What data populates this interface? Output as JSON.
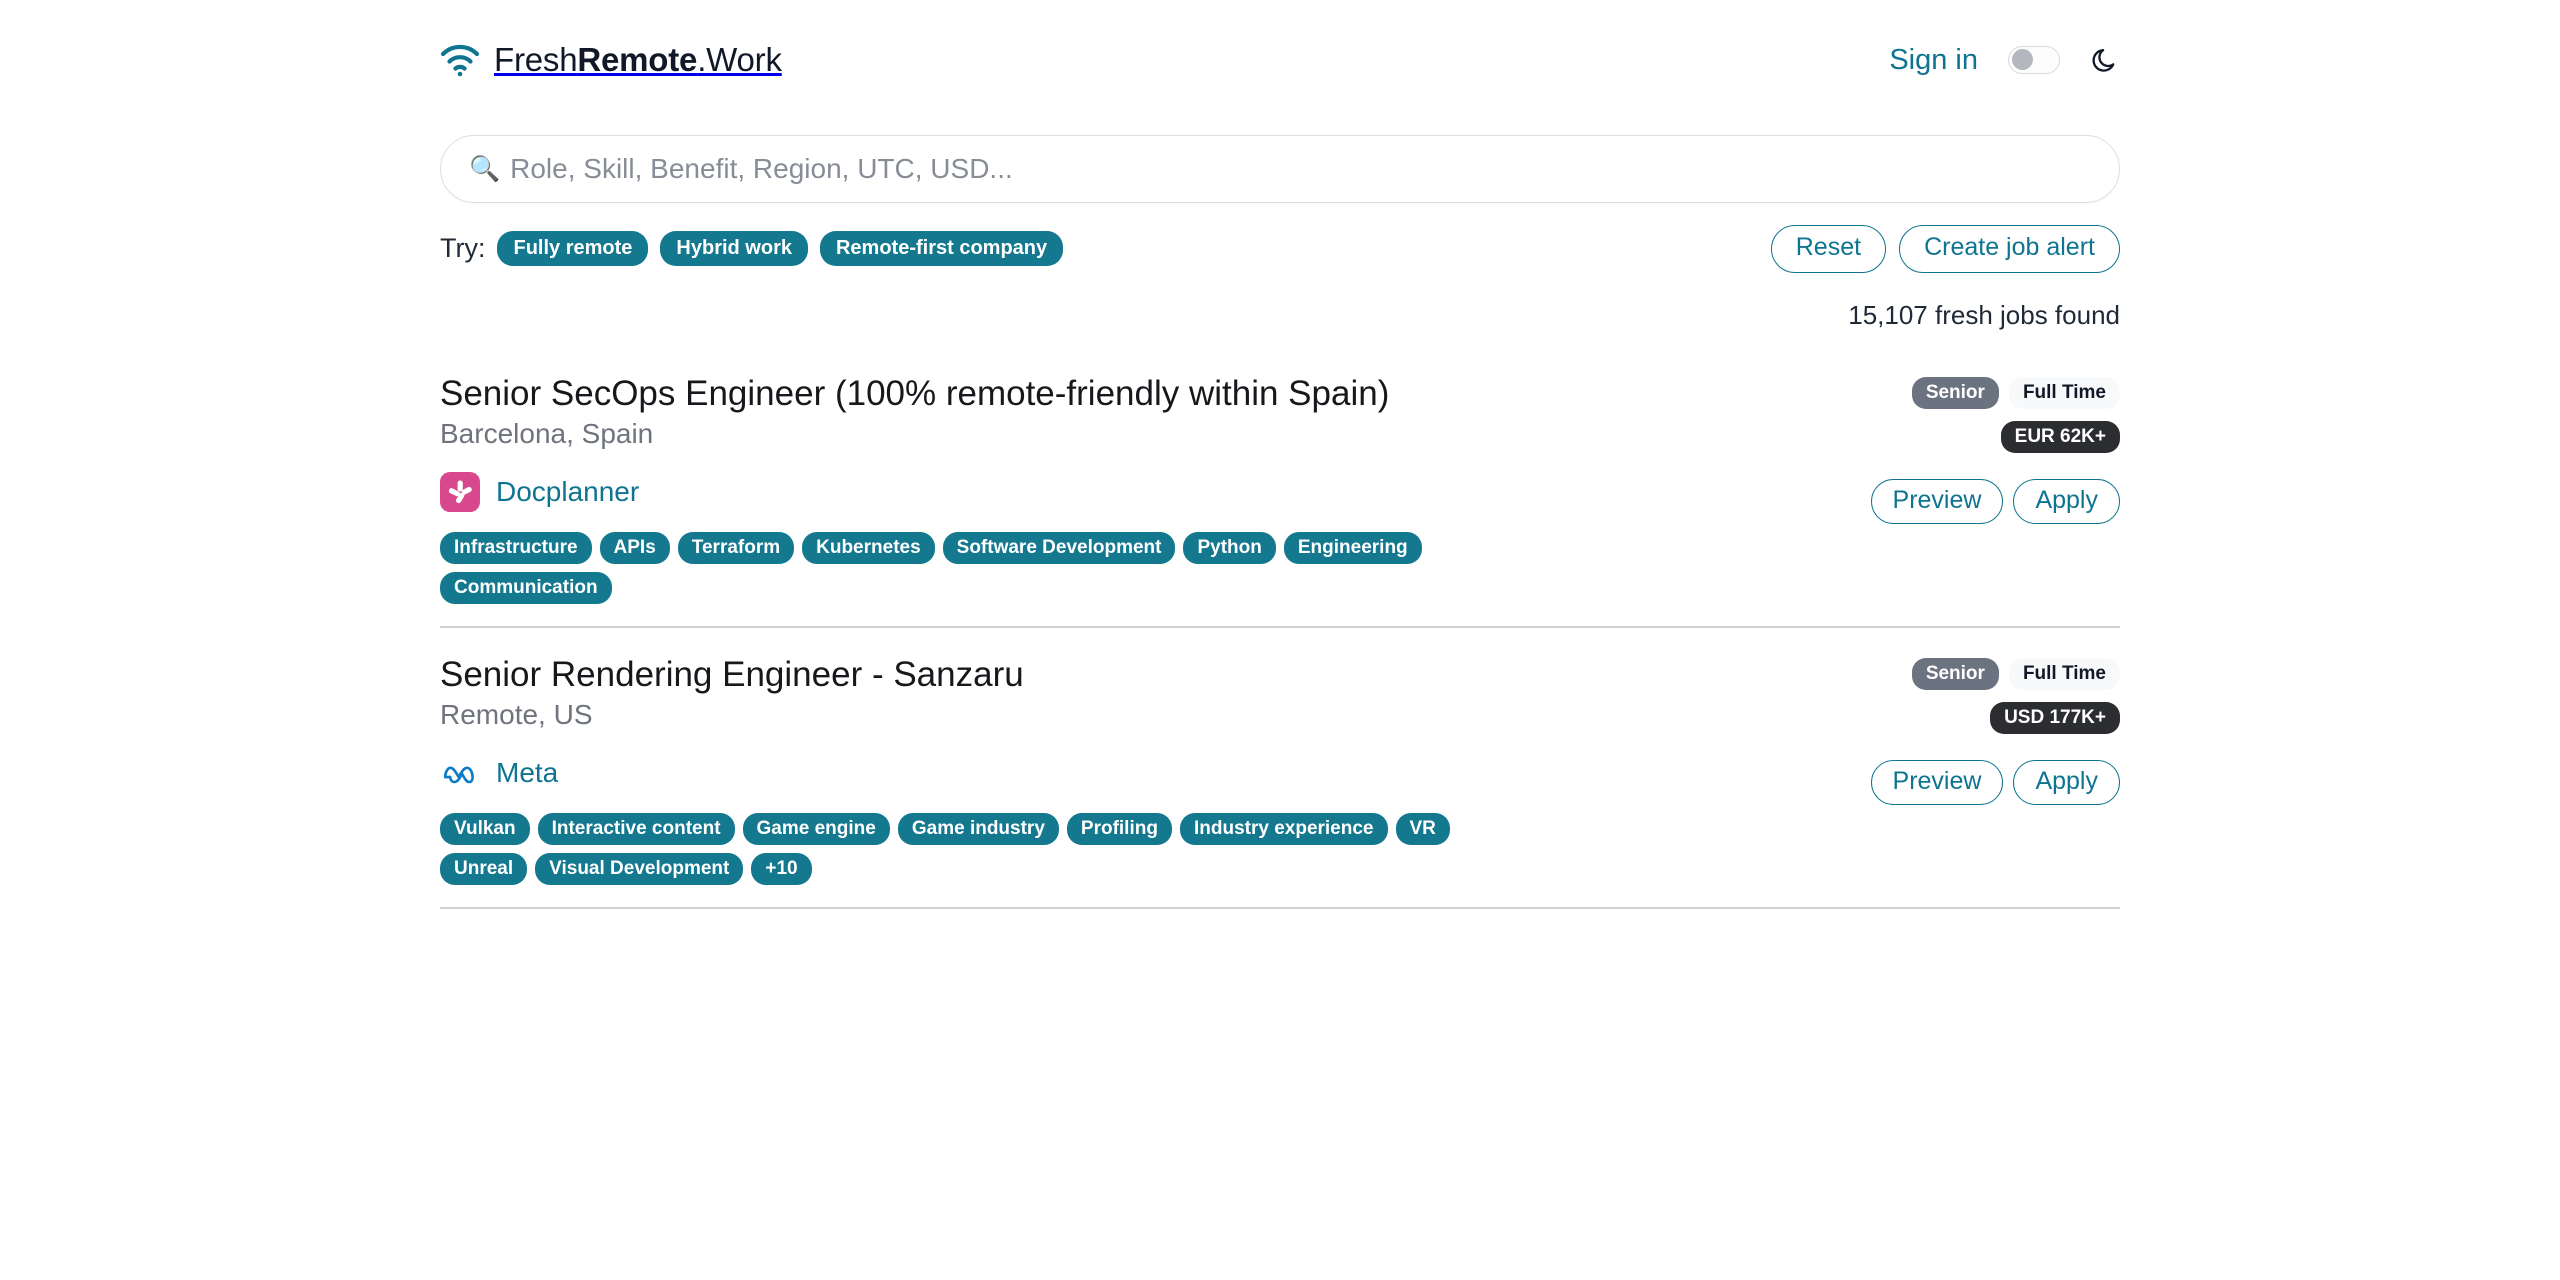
{
  "header": {
    "logo_icon": "wifi-icon",
    "brand_prefix": "Fresh",
    "brand_bold": "Remote",
    "brand_suffix": ".Work",
    "signin_label": "Sign in",
    "theme_toggle_state": "off",
    "dark_mode_icon": "moon-icon"
  },
  "search": {
    "icon": "search-icon",
    "value": "",
    "placeholder": "Role, Skill, Benefit, Region, UTC, USD..."
  },
  "suggestions": {
    "label": "Try:",
    "chips": [
      "Fully remote",
      "Hybrid work",
      "Remote-first company"
    ]
  },
  "actions": {
    "reset_label": "Reset",
    "create_alert_label": "Create job alert"
  },
  "results": {
    "count_text": "15,107 fresh jobs found"
  },
  "colors": {
    "accent_teal": "#0e7490",
    "chip_teal": "#14788f",
    "badge_gray": "#6b7280",
    "badge_dark": "#2b2d31",
    "docplanner_pink": "#d8488c",
    "meta_blue": "#0b7cc7",
    "muted_text": "#6f747c"
  },
  "jobs": [
    {
      "title": "Senior SecOps Engineer (100% remote-friendly within Spain)",
      "location": "Barcelona, Spain",
      "company": "Docplanner",
      "company_logo": "docplanner-logo-icon",
      "seniority": "Senior",
      "employment_type": "Full Time",
      "salary": "EUR 62K+",
      "preview_label": "Preview",
      "apply_label": "Apply",
      "tags": [
        "Infrastructure",
        "APIs",
        "Terraform",
        "Kubernetes",
        "Software Development",
        "Python",
        "Engineering",
        "Communication"
      ]
    },
    {
      "title": "Senior Rendering Engineer - Sanzaru",
      "location": "Remote, US",
      "company": "Meta",
      "company_logo": "meta-logo-icon",
      "seniority": "Senior",
      "employment_type": "Full Time",
      "salary": "USD 177K+",
      "preview_label": "Preview",
      "apply_label": "Apply",
      "tags": [
        "Vulkan",
        "Interactive content",
        "Game engine",
        "Game industry",
        "Profiling",
        "Industry experience",
        "VR",
        "Unreal",
        "Visual Development",
        "+10"
      ]
    }
  ]
}
